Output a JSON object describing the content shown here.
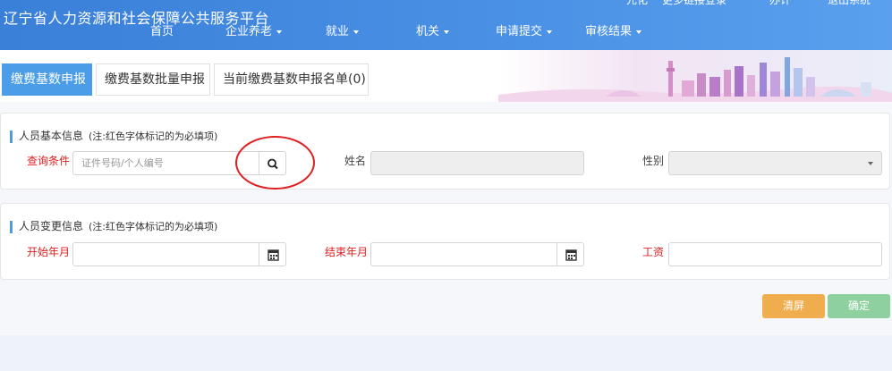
{
  "header": {
    "title": "辽宁省人力资源和社会保障公共服务平台",
    "topline": [
      "元化",
      "更多链接登录",
      "办计",
      "退出系统"
    ],
    "nav": [
      {
        "label": "首页",
        "dropdown": false
      },
      {
        "label": "企业养老",
        "dropdown": true
      },
      {
        "label": "就业",
        "dropdown": true
      },
      {
        "label": "机关",
        "dropdown": true
      },
      {
        "label": "申请提交",
        "dropdown": true
      },
      {
        "label": "审核结果",
        "dropdown": true
      }
    ]
  },
  "tabs": [
    {
      "label": "缴费基数申报",
      "active": true
    },
    {
      "label": "缴费基数批量申报",
      "active": false
    },
    {
      "label": "当前缴费基数申报名单(0)",
      "active": false
    }
  ],
  "basic_info": {
    "title": "人员基本信息",
    "note": "(注:红色字体标记的为必填项)",
    "query_label": "查询条件",
    "query_placeholder": "证件号码/个人编号",
    "name_label": "姓名",
    "gender_label": "性别"
  },
  "change_info": {
    "title": "人员变更信息",
    "note": "(注:红色字体标记的为必填项)",
    "start_label": "开始年月",
    "end_label": "结束年月",
    "wage_label": "工资"
  },
  "buttons": {
    "clear": "清屏",
    "confirm": "确定"
  },
  "colors": {
    "header_blue": "#3a7fd8",
    "active_tab": "#4a9de6",
    "required_red": "#e02020",
    "clear_orange": "#f0ad4e",
    "confirm_green": "#8fd19e"
  }
}
